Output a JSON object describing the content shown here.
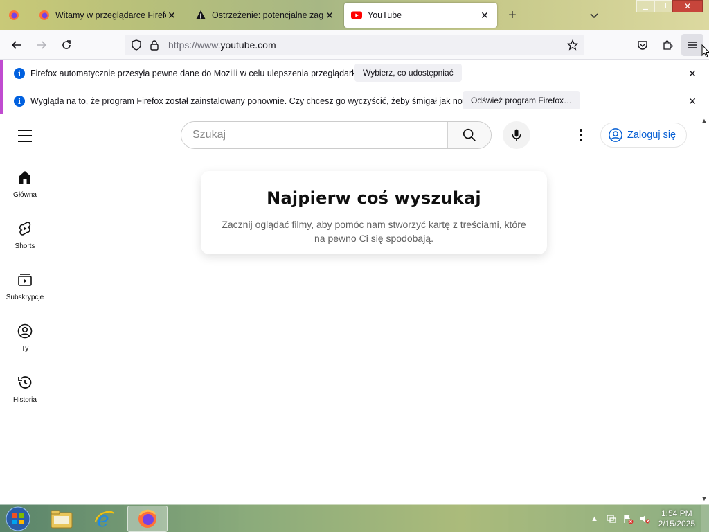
{
  "window": {
    "controls": [
      "minimize",
      "maximize",
      "close"
    ]
  },
  "tabs": [
    {
      "label": "Witamy w przeglądarce Firefox",
      "icon": "firefox-icon",
      "active": false
    },
    {
      "label": "Ostrzeżenie: potencjalne zagroż",
      "icon": "warning-icon",
      "active": false
    },
    {
      "label": "YouTube",
      "icon": "youtube-icon",
      "active": true
    }
  ],
  "navbar": {
    "url_prefix": "https://www.",
    "url_domain": "youtube.com"
  },
  "notifications": [
    {
      "message": "Firefox automatycznie przesyła pewne dane do Mozilli w celu ulepszenia przeglądarki.",
      "button": "Wybierz, co udostępniać"
    },
    {
      "message": "Wygląda na to, że program Firefox został zainstalowany ponownie. Czy chcesz go wyczyścić, żeby śmigał jak nowy?",
      "button": "Odśwież program Firefox…"
    }
  ],
  "youtube": {
    "search_placeholder": "Szukaj",
    "signin_label": "Zaloguj się",
    "sidebar": [
      {
        "label": "Główna",
        "icon": "home-icon"
      },
      {
        "label": "Shorts",
        "icon": "shorts-icon"
      },
      {
        "label": "Subskrypcje",
        "icon": "subscriptions-icon"
      },
      {
        "label": "Ty",
        "icon": "you-icon"
      },
      {
        "label": "Historia",
        "icon": "history-icon"
      }
    ],
    "empty_card": {
      "title": "Najpierw coś wyszukaj",
      "body": "Zacznij oglądać filmy, aby pomóc nam stworzyć kartę z treściami, które na pewno Ci się spodobają."
    }
  },
  "taskbar": {
    "pinned": [
      "explorer-icon",
      "internet-explorer-icon",
      "firefox-icon"
    ],
    "time": "1:54 PM",
    "date": "2/15/2025"
  },
  "colors": {
    "accent": "#0060df",
    "youtube_red": "#ff0000",
    "notification_border": "#c04bd0",
    "link_blue": "#065fd4"
  }
}
